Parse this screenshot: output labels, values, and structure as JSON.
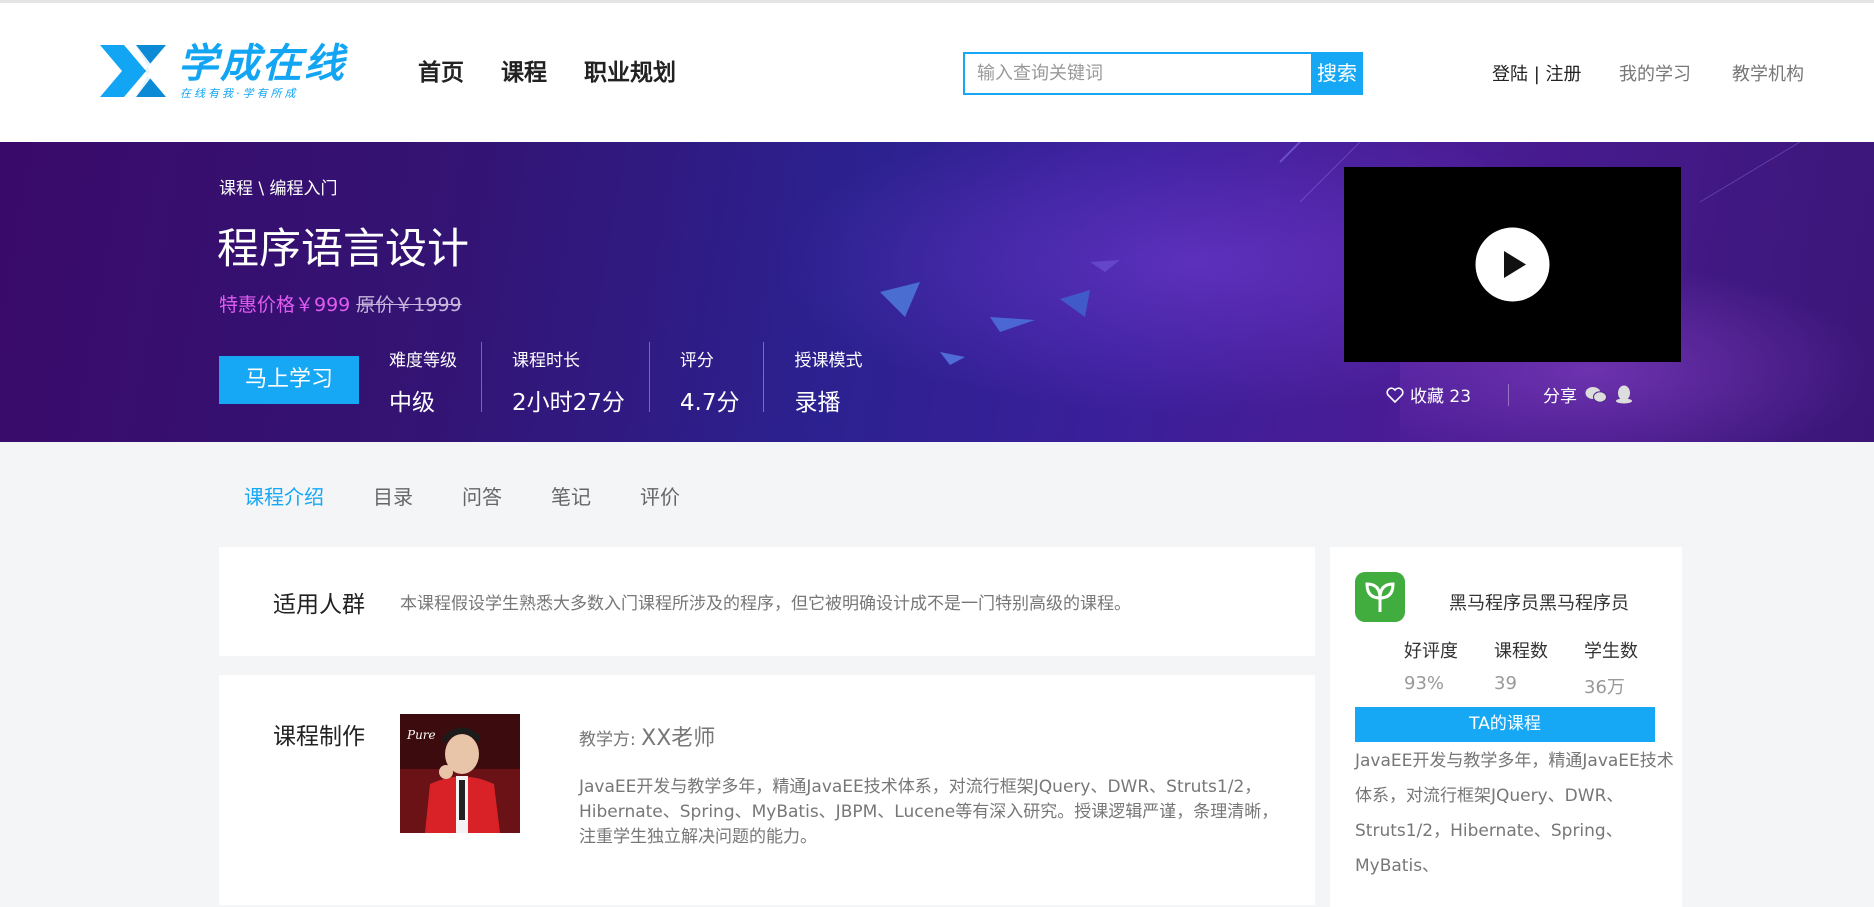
{
  "header": {
    "logo_text": "学成在线",
    "logo_sub": "在线有我·学有所成",
    "nav": [
      "首页",
      "课程",
      "职业规划"
    ],
    "search_placeholder": "输入查询关键词",
    "search_button": "搜索",
    "login_register": "登陆 | 注册",
    "my_learning": "我的学习",
    "institution": "教学机构"
  },
  "banner": {
    "breadcrumb": "课程 \\ 编程入门",
    "title": "程序语言设计",
    "special_price": "特惠价格￥999",
    "original_price": "原价￥1999",
    "learn_button": "马上学习",
    "stats": [
      {
        "label": "难度等级",
        "value": "中级"
      },
      {
        "label": "课程时长",
        "value": "2小时27分"
      },
      {
        "label": "评分",
        "value": "4.7分"
      },
      {
        "label": "授课模式",
        "value": "录播"
      }
    ],
    "favorite": "收藏 23",
    "share": "分享"
  },
  "tabs": [
    "课程介绍",
    "目录",
    "问答",
    "笔记",
    "评价"
  ],
  "audience": {
    "heading": "适用人群",
    "text": "本课程假设学生熟悉大多数入门课程所涉及的程序，但它被明确设计成不是一门特别高级的课程。"
  },
  "production": {
    "heading": "课程制作",
    "teacher_label": "教学方:",
    "teacher_name": "XX老师",
    "photo_text": "Pure",
    "description": "JavaEE开发与教学多年，精通JavaEE技术体系，对流行框架JQuery、DWR、Struts1/2，Hibernate、Spring、MyBatis、JBPM、Lucene等有深入研究。授课逻辑严谨，条理清晰，注重学生独立解决问题的能力。"
  },
  "sidebar": {
    "org_name": "黑马程序员黑马程序员",
    "metrics": [
      {
        "label": "好评度",
        "value": "93%"
      },
      {
        "label": "课程数",
        "value": "39"
      },
      {
        "label": "学生数",
        "value": "36万"
      }
    ],
    "ta_button": "TA的课程",
    "description": "JavaEE开发与教学多年，精通JavaEE技术体系，对流行框架JQuery、DWR、Struts1/2，Hibernate、Spring、MyBatis、"
  },
  "colors": {
    "accent": "#17a8f5",
    "special_price": "#e05cf0",
    "banner": "#331474"
  }
}
